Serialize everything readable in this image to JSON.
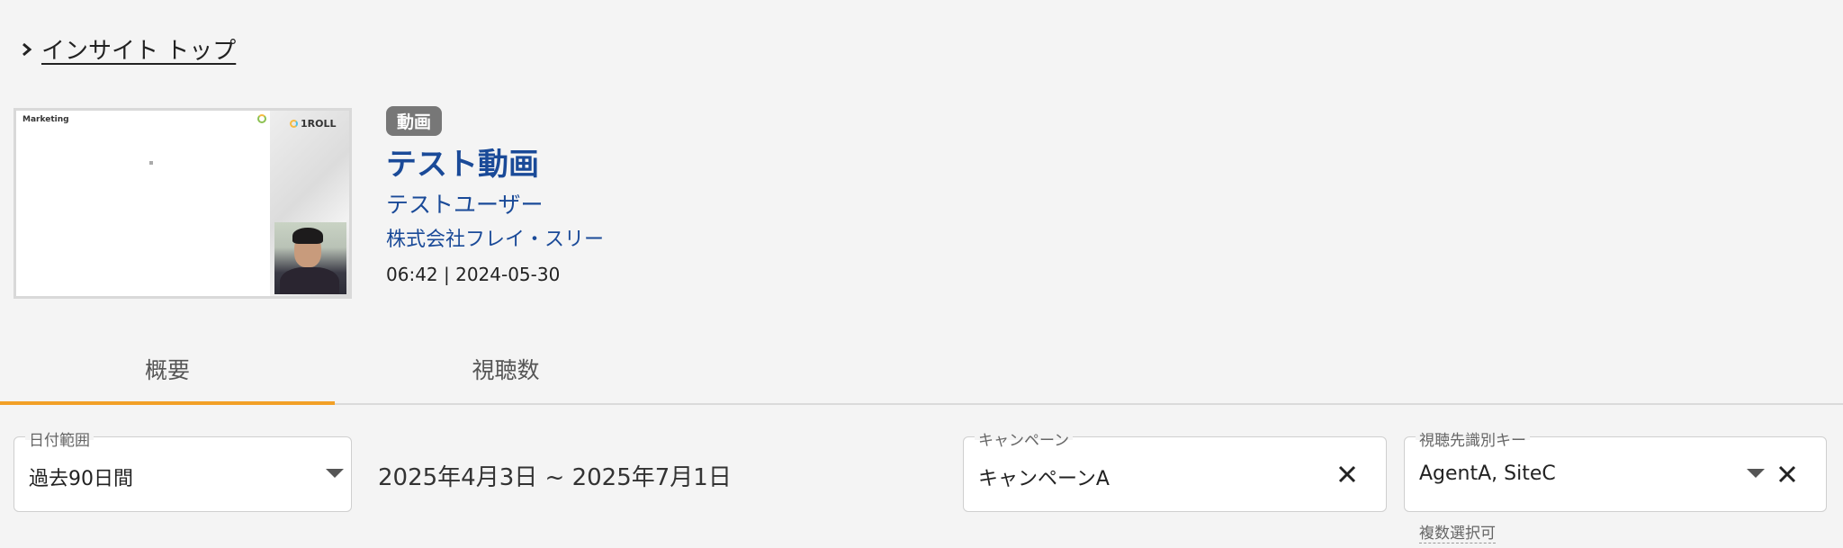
{
  "breadcrumb": {
    "label": "インサイト トップ"
  },
  "video": {
    "badge": "動画",
    "title": "テスト動画",
    "user": "テストユーザー",
    "company": "株式会社フレイ・スリー",
    "meta": "06:42 | 2024-05-30",
    "thumbnail": {
      "slide_title": "Marketing",
      "brand": "1ROLL"
    }
  },
  "tabs": [
    {
      "label": "概要",
      "active": true
    },
    {
      "label": "視聴数",
      "active": false
    }
  ],
  "filters": {
    "date_range": {
      "label": "日付範囲",
      "value": "過去90日間"
    },
    "date_text": "2025年4月3日 ~ 2025年7月1日",
    "campaign": {
      "label": "キャンペーン",
      "value": "キャンペーンA"
    },
    "viewer_key": {
      "label": "視聴先識別キー",
      "value": "AgentA, SiteC",
      "hint": "複数選択可"
    }
  },
  "colors": {
    "accent": "#f2a026",
    "link": "#1a4a98",
    "badge": "#777777"
  },
  "icons": {
    "breadcrumb": "chevron-right-icon",
    "dropdown": "caret-down-icon",
    "clear": "close-icon"
  }
}
